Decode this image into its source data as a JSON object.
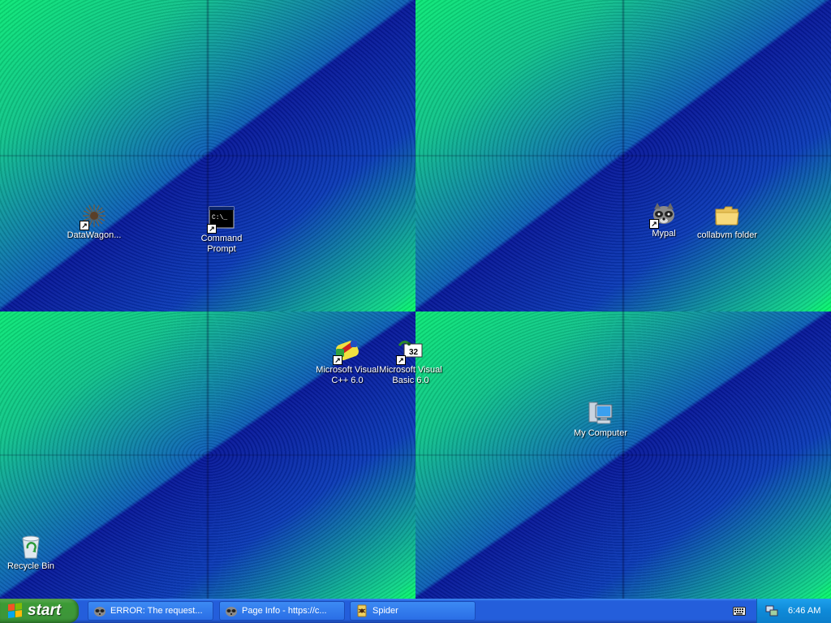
{
  "desktop": {
    "icons": [
      {
        "id": "datawagon",
        "label": "DataWagon..."
      },
      {
        "id": "command-prompt",
        "label": "Command\nPrompt"
      },
      {
        "id": "mypal",
        "label": "Mypal"
      },
      {
        "id": "collabvm-folder",
        "label": "collabvm folder"
      },
      {
        "id": "visual-cpp",
        "label": "Microsoft Visual\nC++ 6.0"
      },
      {
        "id": "visual-basic",
        "label": "Microsoft Visual\nBasic 6.0"
      },
      {
        "id": "my-computer",
        "label": "My Computer"
      },
      {
        "id": "recycle-bin",
        "label": "Recycle Bin"
      }
    ]
  },
  "taskbar": {
    "start_label": "start",
    "tasks": [
      {
        "label": "ERROR: The request..."
      },
      {
        "label": "Page Info - https://c..."
      },
      {
        "label": "Spider"
      }
    ],
    "tray": {
      "clock": "6:46 AM"
    }
  },
  "colors": {
    "taskbar_blue": "#245edb",
    "start_green": "#3c9a35",
    "tray_blue": "#0f8ad8",
    "wallpaper_green": "#0be877",
    "wallpaper_blue": "#07189a"
  }
}
